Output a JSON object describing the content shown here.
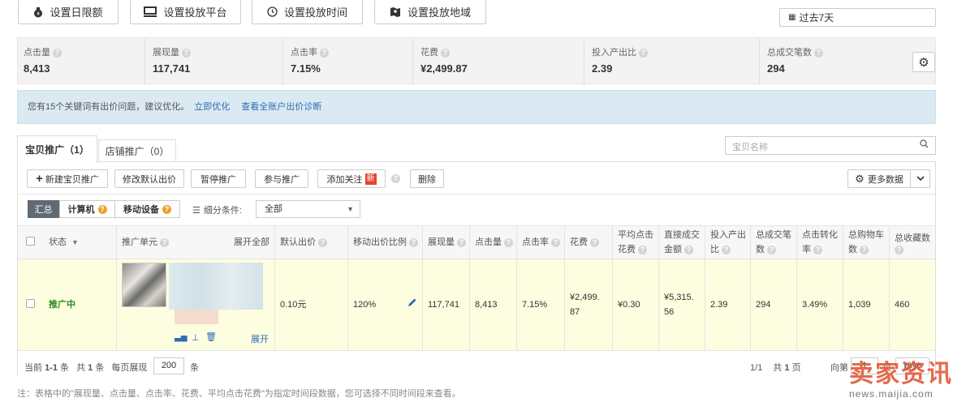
{
  "toolbar": {
    "daily_limit": "设置日限额",
    "platform": "设置投放平台",
    "time": "设置投放时间",
    "region": "设置投放地域",
    "date_range": "过去7天"
  },
  "metrics": [
    {
      "label": "点击量",
      "value": "8,413"
    },
    {
      "label": "展现量",
      "value": "117,741"
    },
    {
      "label": "点击率",
      "value": "7.15%"
    },
    {
      "label": "花费",
      "value": "¥2,499.87"
    },
    {
      "label": "投入产出比",
      "value": "2.39"
    },
    {
      "label": "总成交笔数",
      "value": "294"
    }
  ],
  "notice": {
    "text": "您有15个关键词有出价问题，建议优化。",
    "link1": "立即优化",
    "link2": "查看全账户出价诊断"
  },
  "tabs": {
    "tab1": "宝贝推广（1）",
    "tab2": "店铺推广（0）",
    "search_placeholder": "宝贝名称"
  },
  "actions": {
    "new": "新建宝贝推广",
    "modify_bid": "修改默认出价",
    "pause": "暂停推广",
    "join": "参与推广",
    "follow": "添加关注",
    "new_badge": "新",
    "delete": "删除",
    "more_data": "更多数据"
  },
  "filters": {
    "summary": "汇总",
    "pc": "计算机",
    "mobile": "移动设备",
    "condition_label": "细分条件:",
    "condition_value": "全部"
  },
  "table": {
    "headers": {
      "status": "状态",
      "unit": "推广单元",
      "expand_all": "展开全部",
      "default_bid": "默认出价",
      "mobile_ratio": "移动出价比例",
      "impressions": "展现量",
      "clicks": "点击量",
      "ctr": "点击率",
      "cost": "花费",
      "avg_cpc_1": "平均点击",
      "avg_cpc_2": "花费",
      "direct_1": "直接成交",
      "direct_2": "金额",
      "roi_1": "投入产出",
      "roi_2": "比",
      "orders_1": "总成交笔",
      "orders_2": "数",
      "conv_1": "点击转化",
      "conv_2": "率",
      "cart_1": "总购物车",
      "cart_2": "数",
      "fav": "总收藏数"
    },
    "row": {
      "status": "推广中",
      "expand": "展开",
      "default_bid": "0.10元",
      "mobile_ratio": "120%",
      "impressions": "117,741",
      "clicks": "8,413",
      "ctr": "7.15%",
      "cost_1": "¥2,499.",
      "cost_2": "87",
      "avg_cpc": "¥0.30",
      "direct_1": "¥5,315.",
      "direct_2": "56",
      "roi": "2.39",
      "orders": "294",
      "conv": "3.49%",
      "cart": "1,039",
      "fav": "460"
    }
  },
  "footer": {
    "current_label": "当前",
    "current_value": "1-1",
    "items_unit": "条",
    "total_label": "共",
    "total_value": "1",
    "per_page_label": "每页展现",
    "per_page_value": "200",
    "page_info": "1/1",
    "total_pages_label": "共",
    "total_pages_value": "1",
    "pages_unit": "页",
    "goto_label": "向第",
    "goto_value": "1",
    "goto_unit": "页",
    "goto_btn": "跳转"
  },
  "note": "注：表格中的\"展现量、点击量、点击率、花费、平均点击花费\"为指定时间段数据，您可选择不同时间段来查看。",
  "watermark": {
    "main": "卖家资讯",
    "url": "news.maijia.com"
  }
}
